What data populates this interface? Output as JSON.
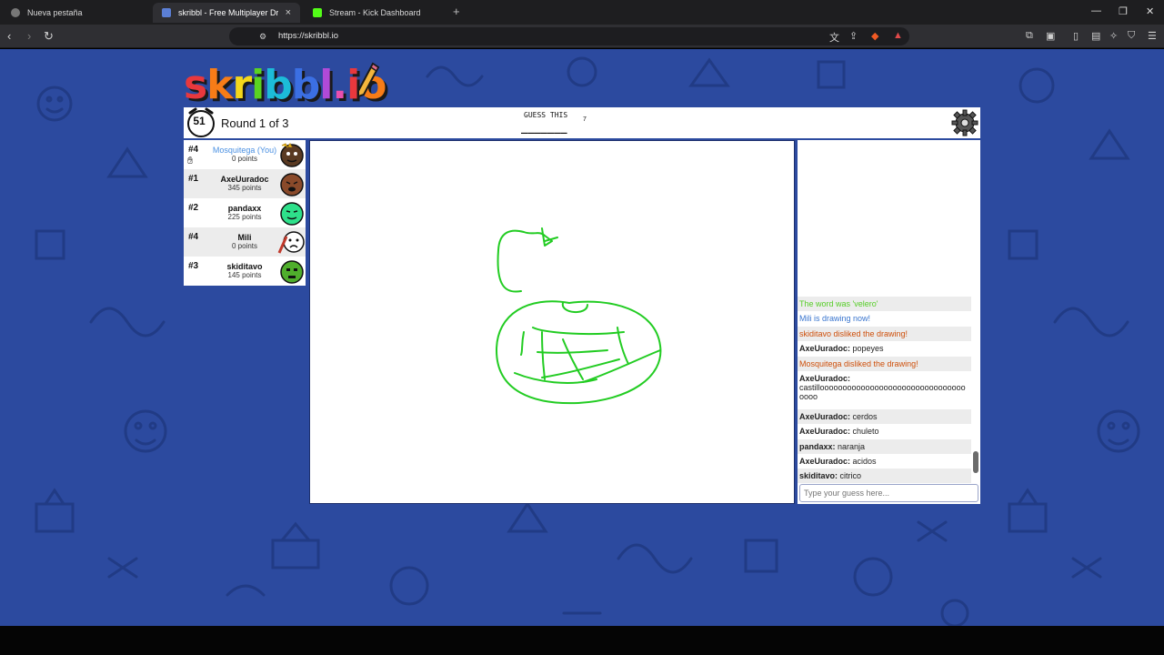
{
  "browser": {
    "tabs": [
      {
        "label": "Nueva pestaña",
        "active": false
      },
      {
        "label": "skribbl - Free Multiplayer Drawin",
        "active": true
      },
      {
        "label": "Stream - Kick Dashboard",
        "active": false
      }
    ],
    "url": "https://skribbl.io"
  },
  "game": {
    "logo": "skribbl.io",
    "timer": "51",
    "round": "Round 1 of 3",
    "guess_label": "GUESS THIS",
    "word_hint": "_______",
    "word_length": "7"
  },
  "players": [
    {
      "rank": "#4",
      "name": "Mosquitega (You)",
      "points": "0 points",
      "you": true
    },
    {
      "rank": "#1",
      "name": "AxeUuradoc",
      "points": "345 points",
      "you": false
    },
    {
      "rank": "#2",
      "name": "pandaxx",
      "points": "225 points",
      "you": false
    },
    {
      "rank": "#4",
      "name": "Mili",
      "points": "0 points",
      "you": false
    },
    {
      "rank": "#3",
      "name": "skiditavo",
      "points": "145 points",
      "you": false
    }
  ],
  "chat": {
    "messages": [
      {
        "text": "The word was 'velero'",
        "type": "green"
      },
      {
        "text": "Mili is drawing now!",
        "type": "blue"
      },
      {
        "text": "skiditavo disliked the drawing!",
        "type": "red"
      },
      {
        "author": "AxeUuradoc:",
        "text": "popeyes"
      },
      {
        "text": "Mosquitega disliked the drawing!",
        "type": "red"
      },
      {
        "author": "AxeUuradoc:",
        "text": "castilloooooooooooooooooooooooooooooooooooo"
      },
      {
        "author": "AxeUuradoc:",
        "text": "cerdos"
      },
      {
        "author": "AxeUuradoc:",
        "text": "chuleto"
      },
      {
        "author": "pandaxx:",
        "text": "naranja"
      },
      {
        "author": "AxeUuradoc:",
        "text": "acidos"
      },
      {
        "author": "skiditavo:",
        "text": "citrico"
      }
    ],
    "input_placeholder": "Type your guess here..."
  },
  "colors": {
    "background": "#2c4a9f",
    "drawing_stroke": "#22cc22"
  }
}
